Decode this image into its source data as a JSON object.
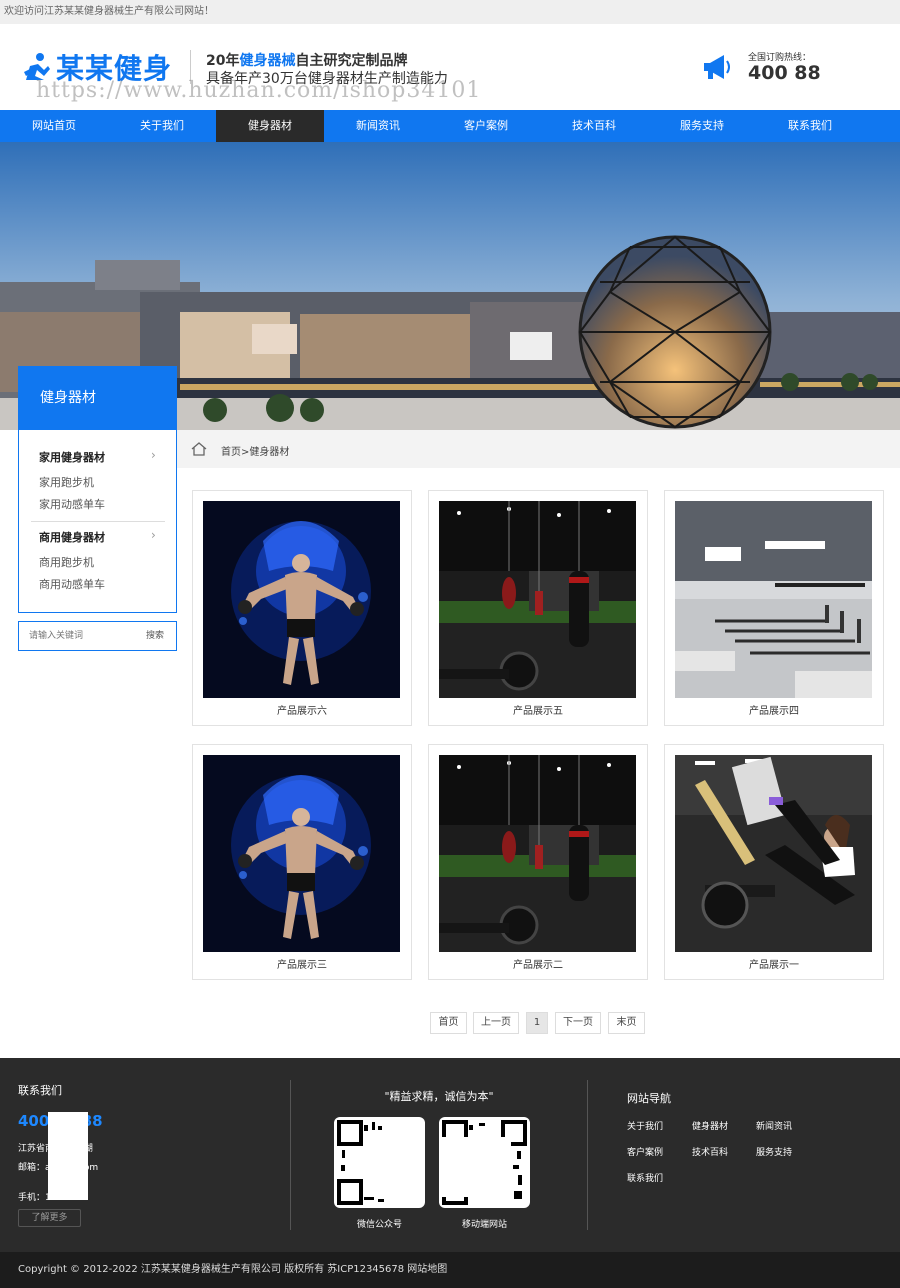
{
  "topbar": {
    "welcome": "欢迎访问江苏某某健身器械生产有限公司网站！"
  },
  "header": {
    "logo_text": "某某健身",
    "slogan_prefix": "20年",
    "slogan_highlight": "健身器械",
    "slogan_suffix": "自主研究定制品牌",
    "slogan_line2": "具备年产30万台健身器材生产制造能力",
    "watermark": "https://www.huzhan.com/ishop34101",
    "hotline_label": "全国订购热线：",
    "hotline_number": "400        88"
  },
  "nav": {
    "items": [
      "网站首页",
      "关于我们",
      "健身器材",
      "新闻资讯",
      "客户案例",
      "技术百科",
      "服务支持",
      "联系我们"
    ],
    "active_index": 2
  },
  "sidebar": {
    "title": "健身器材",
    "categories": [
      {
        "title": "家用健身器材",
        "items": [
          "家用跑步机",
          "家用动感单车"
        ]
      },
      {
        "title": "商用健身器材",
        "items": [
          "商用跑步机",
          "商用动感单车"
        ]
      }
    ],
    "search_placeholder": "请输入关键词",
    "search_button": "搜索"
  },
  "breadcrumb": {
    "home": "首页",
    "separator": ">",
    "current": "健身器材"
  },
  "products": [
    {
      "name": "产品展示六",
      "image": "fighter"
    },
    {
      "name": "产品展示五",
      "image": "boxing-gym"
    },
    {
      "name": "产品展示四",
      "image": "treadmills"
    },
    {
      "name": "产品展示三",
      "image": "fighter"
    },
    {
      "name": "产品展示二",
      "image": "boxing-gym"
    },
    {
      "name": "产品展示一",
      "image": "leg-press-woman"
    }
  ],
  "pagination": {
    "first": "首页",
    "prev": "上一页",
    "current": "1",
    "next": "下一页",
    "last": "末页"
  },
  "footer": {
    "contact_title": "联系我们",
    "phone": "400-      3888",
    "address": "江苏省南        区玄武湖",
    "email": "邮箱：a        dmin.com",
    "mobile": "手机：1          888",
    "more_button": "了解更多",
    "quote": "\"精益求精，诚信为本\"",
    "qr_wechat_label": "微信公众号",
    "qr_mobile_label": "移动端网站",
    "nav_title": "网站导航",
    "nav_links": [
      "关于我们",
      "健身器材",
      "新闻资讯",
      "客户案例",
      "技术百科",
      "服务支持",
      "联系我们"
    ]
  },
  "copyright": "Copyright © 2012-2022 江苏某某健身器械生产有限公司 版权所有 苏ICP12345678 网站地图",
  "colors": {
    "brand_blue": "#1077f0",
    "nav_active": "#2a2a2a",
    "footer_bg": "#2b2b2b",
    "copyright_bg": "#1c1c1c"
  }
}
